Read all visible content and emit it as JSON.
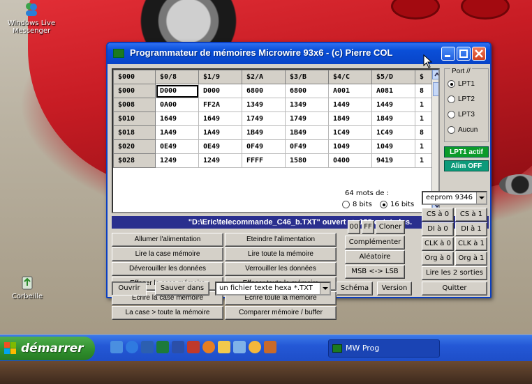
{
  "desktop": {
    "icons": [
      {
        "label": "Windows Live Messenger"
      },
      {
        "label": "Corbeille"
      }
    ],
    "wallpaper_accent": "#c71c24"
  },
  "taskbar": {
    "start_label": "démarrer",
    "task_label": "MW Prog",
    "quicklaunch_icons": [
      "show-desktop-icon",
      "ie-icon",
      "media-icon",
      "excel-icon",
      "word-icon",
      "paint-icon",
      "firefox-icon",
      "folder-icon",
      "network-icon",
      "messenger-icon",
      "user-icon"
    ]
  },
  "window": {
    "title": "Programmateur de mémoires Microwire 93x6 - (c) Pierre COL",
    "grid": {
      "headers": [
        "$000",
        "$0/8",
        "$1/9",
        "$2/A",
        "$3/B",
        "$4/C",
        "$5/D",
        "$"
      ],
      "rows": [
        [
          "$000",
          "D000",
          "D000",
          "6800",
          "6800",
          "A001",
          "A081",
          "8"
        ],
        [
          "$008",
          "0A00",
          "FF2A",
          "1349",
          "1349",
          "1449",
          "1449",
          "1"
        ],
        [
          "$010",
          "1649",
          "1649",
          "1749",
          "1749",
          "1849",
          "1849",
          "1"
        ],
        [
          "$018",
          "1A49",
          "1A49",
          "1B49",
          "1B49",
          "1C49",
          "1C49",
          "8"
        ],
        [
          "$020",
          "0E49",
          "0E49",
          "0F49",
          "0F49",
          "1049",
          "1049",
          "1"
        ],
        [
          "$028",
          "1249",
          "1249",
          "FFFF",
          "1580",
          "0400",
          "9419",
          "1"
        ]
      ]
    },
    "port": {
      "legend": "Port //",
      "options": [
        "LPT1",
        "LPT2",
        "LPT3",
        "Aucun"
      ],
      "selected": "LPT1"
    },
    "status": {
      "lpt": "LPT1 actif",
      "alim": "Alim OFF",
      "lpt_color": "#0b9b2a",
      "alim_color": "#0c9a7a"
    },
    "info_bar": "\"D:\\Eric\\telecommande_C46_b.TXT\" ouvert => 128 octets lus.",
    "buttons_left": [
      [
        "Allumer l'alimentation",
        "Eteindre l'alimentation"
      ],
      [
        "Lire la case mémoire",
        "Lire toute la mémoire"
      ],
      [
        "Déverouiller les données",
        "Verrouiller les données"
      ],
      [
        "Effacer la case mémoire",
        "Effacer toute la mémoire"
      ],
      [
        "Ecrire la case mémoire",
        "Ecrire toute la mémoire"
      ],
      [
        "La case > toute la mémoire",
        "Comparer mémoire / buffer"
      ]
    ],
    "mots": {
      "label": "64 mots de :",
      "opt8": "8 bits",
      "opt16": "16 bits",
      "selected": "16 bits"
    },
    "buttons_mid": {
      "b00": "00",
      "bff": "FF",
      "cloner": "Cloner",
      "complementer": "Complémenter",
      "aleatoire": "Aléatoire",
      "msb_lsb": "MSB <-> LSB"
    },
    "eeprom_select": "eeprom 9346",
    "buttons_right": [
      [
        "CS à 0",
        "CS à 1"
      ],
      [
        "DI à 0",
        "DI à 1"
      ],
      [
        "CLK à 0",
        "CLK à 1"
      ],
      [
        "Org à 0",
        "Org à 1"
      ]
    ],
    "lire_sorties": "Lire les 2 sorties",
    "bottom": {
      "ouvrir": "Ouvrir",
      "sauver": "Sauver dans",
      "format": "un fichier texte hexa *.TXT",
      "schema": "Schéma",
      "version": "Version",
      "quitter": "Quitter"
    }
  }
}
